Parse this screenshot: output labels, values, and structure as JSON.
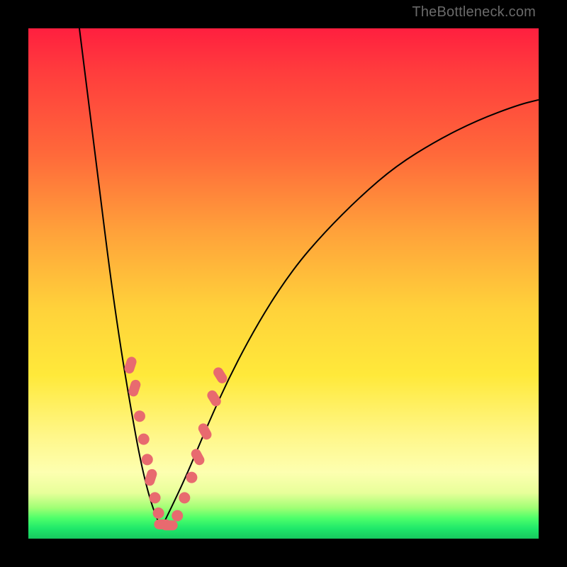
{
  "watermark": "TheBottleneck.com",
  "colors": {
    "frame_bg": "#000000",
    "gradient_top": "#ff1f3f",
    "gradient_mid1": "#ff6a3a",
    "gradient_mid2": "#ffd23a",
    "gradient_mid3": "#fff78a",
    "gradient_bottom": "#17c95f",
    "curve": "#000000",
    "marker": "#e86a6f"
  },
  "chart_data": {
    "type": "line",
    "title": "",
    "xlabel": "",
    "ylabel": "",
    "xlim": [
      0,
      100
    ],
    "ylim": [
      0,
      100
    ],
    "note": "x,y normalized to 0–100 over the plot area; y=0 is bottom, y=100 is top. Two V-shaped branches meeting near (26, 2).",
    "series": [
      {
        "name": "left-branch",
        "x": [
          10,
          12,
          14,
          16,
          18,
          20,
          22,
          24,
          26
        ],
        "y": [
          100,
          84,
          68,
          52,
          38,
          26,
          15,
          7,
          2
        ]
      },
      {
        "name": "right-branch",
        "x": [
          26,
          30,
          35,
          40,
          46,
          52,
          58,
          65,
          72,
          80,
          88,
          96,
          100
        ],
        "y": [
          2,
          10,
          22,
          33,
          44,
          53,
          60,
          67,
          73,
          78,
          82,
          85,
          86
        ]
      }
    ],
    "markers": {
      "note": "Salmon circular/pill markers clustered on both branches in the lower third of the chart.",
      "points": [
        {
          "x": 20.0,
          "y": 34.0,
          "shape": "pill",
          "angle": -72
        },
        {
          "x": 20.8,
          "y": 29.5,
          "shape": "pill",
          "angle": -72
        },
        {
          "x": 21.8,
          "y": 24.0,
          "shape": "circle"
        },
        {
          "x": 22.6,
          "y": 19.5,
          "shape": "circle"
        },
        {
          "x": 23.3,
          "y": 15.5,
          "shape": "circle"
        },
        {
          "x": 24.0,
          "y": 12.0,
          "shape": "pill",
          "angle": -72
        },
        {
          "x": 24.8,
          "y": 8.0,
          "shape": "circle"
        },
        {
          "x": 25.5,
          "y": 5.0,
          "shape": "circle"
        },
        {
          "x": 26.3,
          "y": 2.8,
          "shape": "pill",
          "angle": 0
        },
        {
          "x": 27.6,
          "y": 2.6,
          "shape": "pill",
          "angle": 0
        },
        {
          "x": 29.2,
          "y": 4.5,
          "shape": "circle"
        },
        {
          "x": 30.6,
          "y": 8.0,
          "shape": "circle"
        },
        {
          "x": 32.0,
          "y": 12.0,
          "shape": "circle"
        },
        {
          "x": 33.2,
          "y": 16.0,
          "shape": "pill",
          "angle": 62
        },
        {
          "x": 34.6,
          "y": 21.0,
          "shape": "pill",
          "angle": 62
        },
        {
          "x": 36.4,
          "y": 27.5,
          "shape": "pill",
          "angle": 58
        },
        {
          "x": 37.6,
          "y": 32.0,
          "shape": "pill",
          "angle": 58
        }
      ]
    }
  }
}
